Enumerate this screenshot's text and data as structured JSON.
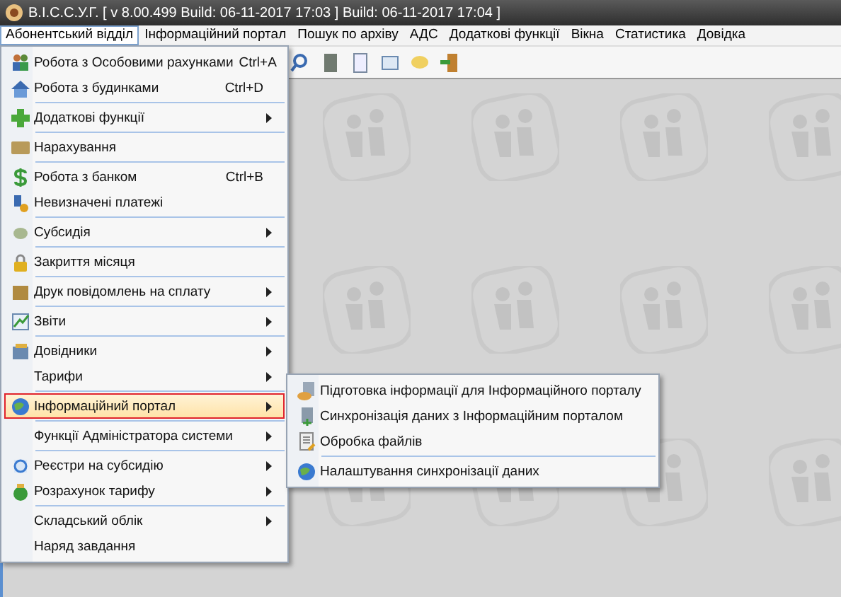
{
  "window": {
    "title": "B.I.C.C.У.Г. [ v 8.00.499 Build: 06-11-2017 17:03 ]   Build: 06-11-2017 17:04 ]"
  },
  "menubar": [
    {
      "label": "Абонентський відділ",
      "selected": true
    },
    {
      "label": "Інформаційний портал",
      "selected": false
    },
    {
      "label": "Пошук по архіву",
      "selected": false
    },
    {
      "label": "АДС",
      "selected": false
    },
    {
      "label": "Додаткові функції",
      "selected": false
    },
    {
      "label": "Вікна",
      "selected": false
    },
    {
      "label": "Статистика",
      "selected": false
    },
    {
      "label": "Довідка",
      "selected": false
    }
  ],
  "menu": {
    "groups": [
      [
        {
          "label": "Робота з Особовими рахунками",
          "shortcut": "Ctrl+A",
          "submenu": false,
          "selected": false
        },
        {
          "label": "Робота з будинками",
          "shortcut": "Ctrl+D",
          "submenu": false,
          "selected": false
        }
      ],
      [
        {
          "label": "Додаткові функції",
          "submenu": true,
          "selected": false
        }
      ],
      [
        {
          "label": "Нарахування",
          "submenu": false,
          "selected": false
        }
      ],
      [
        {
          "label": "Робота з банком",
          "shortcut": "Ctrl+B",
          "submenu": false,
          "selected": false
        },
        {
          "label": "Невизначені платежі",
          "submenu": false,
          "selected": false
        }
      ],
      [
        {
          "label": "Субсидія",
          "submenu": true,
          "selected": false
        }
      ],
      [
        {
          "label": "Закриття місяця",
          "submenu": false,
          "selected": false
        }
      ],
      [
        {
          "label": "Друк повідомлень на сплату",
          "submenu": true,
          "selected": false
        }
      ],
      [
        {
          "label": "Звіти",
          "submenu": true,
          "selected": false
        }
      ],
      [
        {
          "label": "Довідники",
          "submenu": true,
          "selected": false
        },
        {
          "label": "Тарифи",
          "submenu": true,
          "selected": false
        }
      ],
      [
        {
          "label": "Інформаційний портал",
          "submenu": true,
          "selected": true
        }
      ],
      [
        {
          "label": "Функції Адміністратора системи",
          "submenu": true,
          "selected": false
        }
      ],
      [
        {
          "label": "Реєстри на субсидію",
          "submenu": true,
          "selected": false
        },
        {
          "label": "Розрахунок тарифу",
          "submenu": true,
          "selected": false
        }
      ],
      [
        {
          "label": "Складський облік",
          "submenu": true,
          "selected": false
        },
        {
          "label": "Наряд завдання",
          "submenu": false,
          "selected": false
        }
      ]
    ]
  },
  "submenu": {
    "groups": [
      [
        {
          "label": "Підготовка інформації для Інформаційного порталу"
        },
        {
          "label": "Синхронізація даних з Інформаційним порталом"
        },
        {
          "label": "Обробка файлів"
        }
      ],
      [
        {
          "label": "Налаштування синхронізації даних"
        }
      ]
    ]
  }
}
